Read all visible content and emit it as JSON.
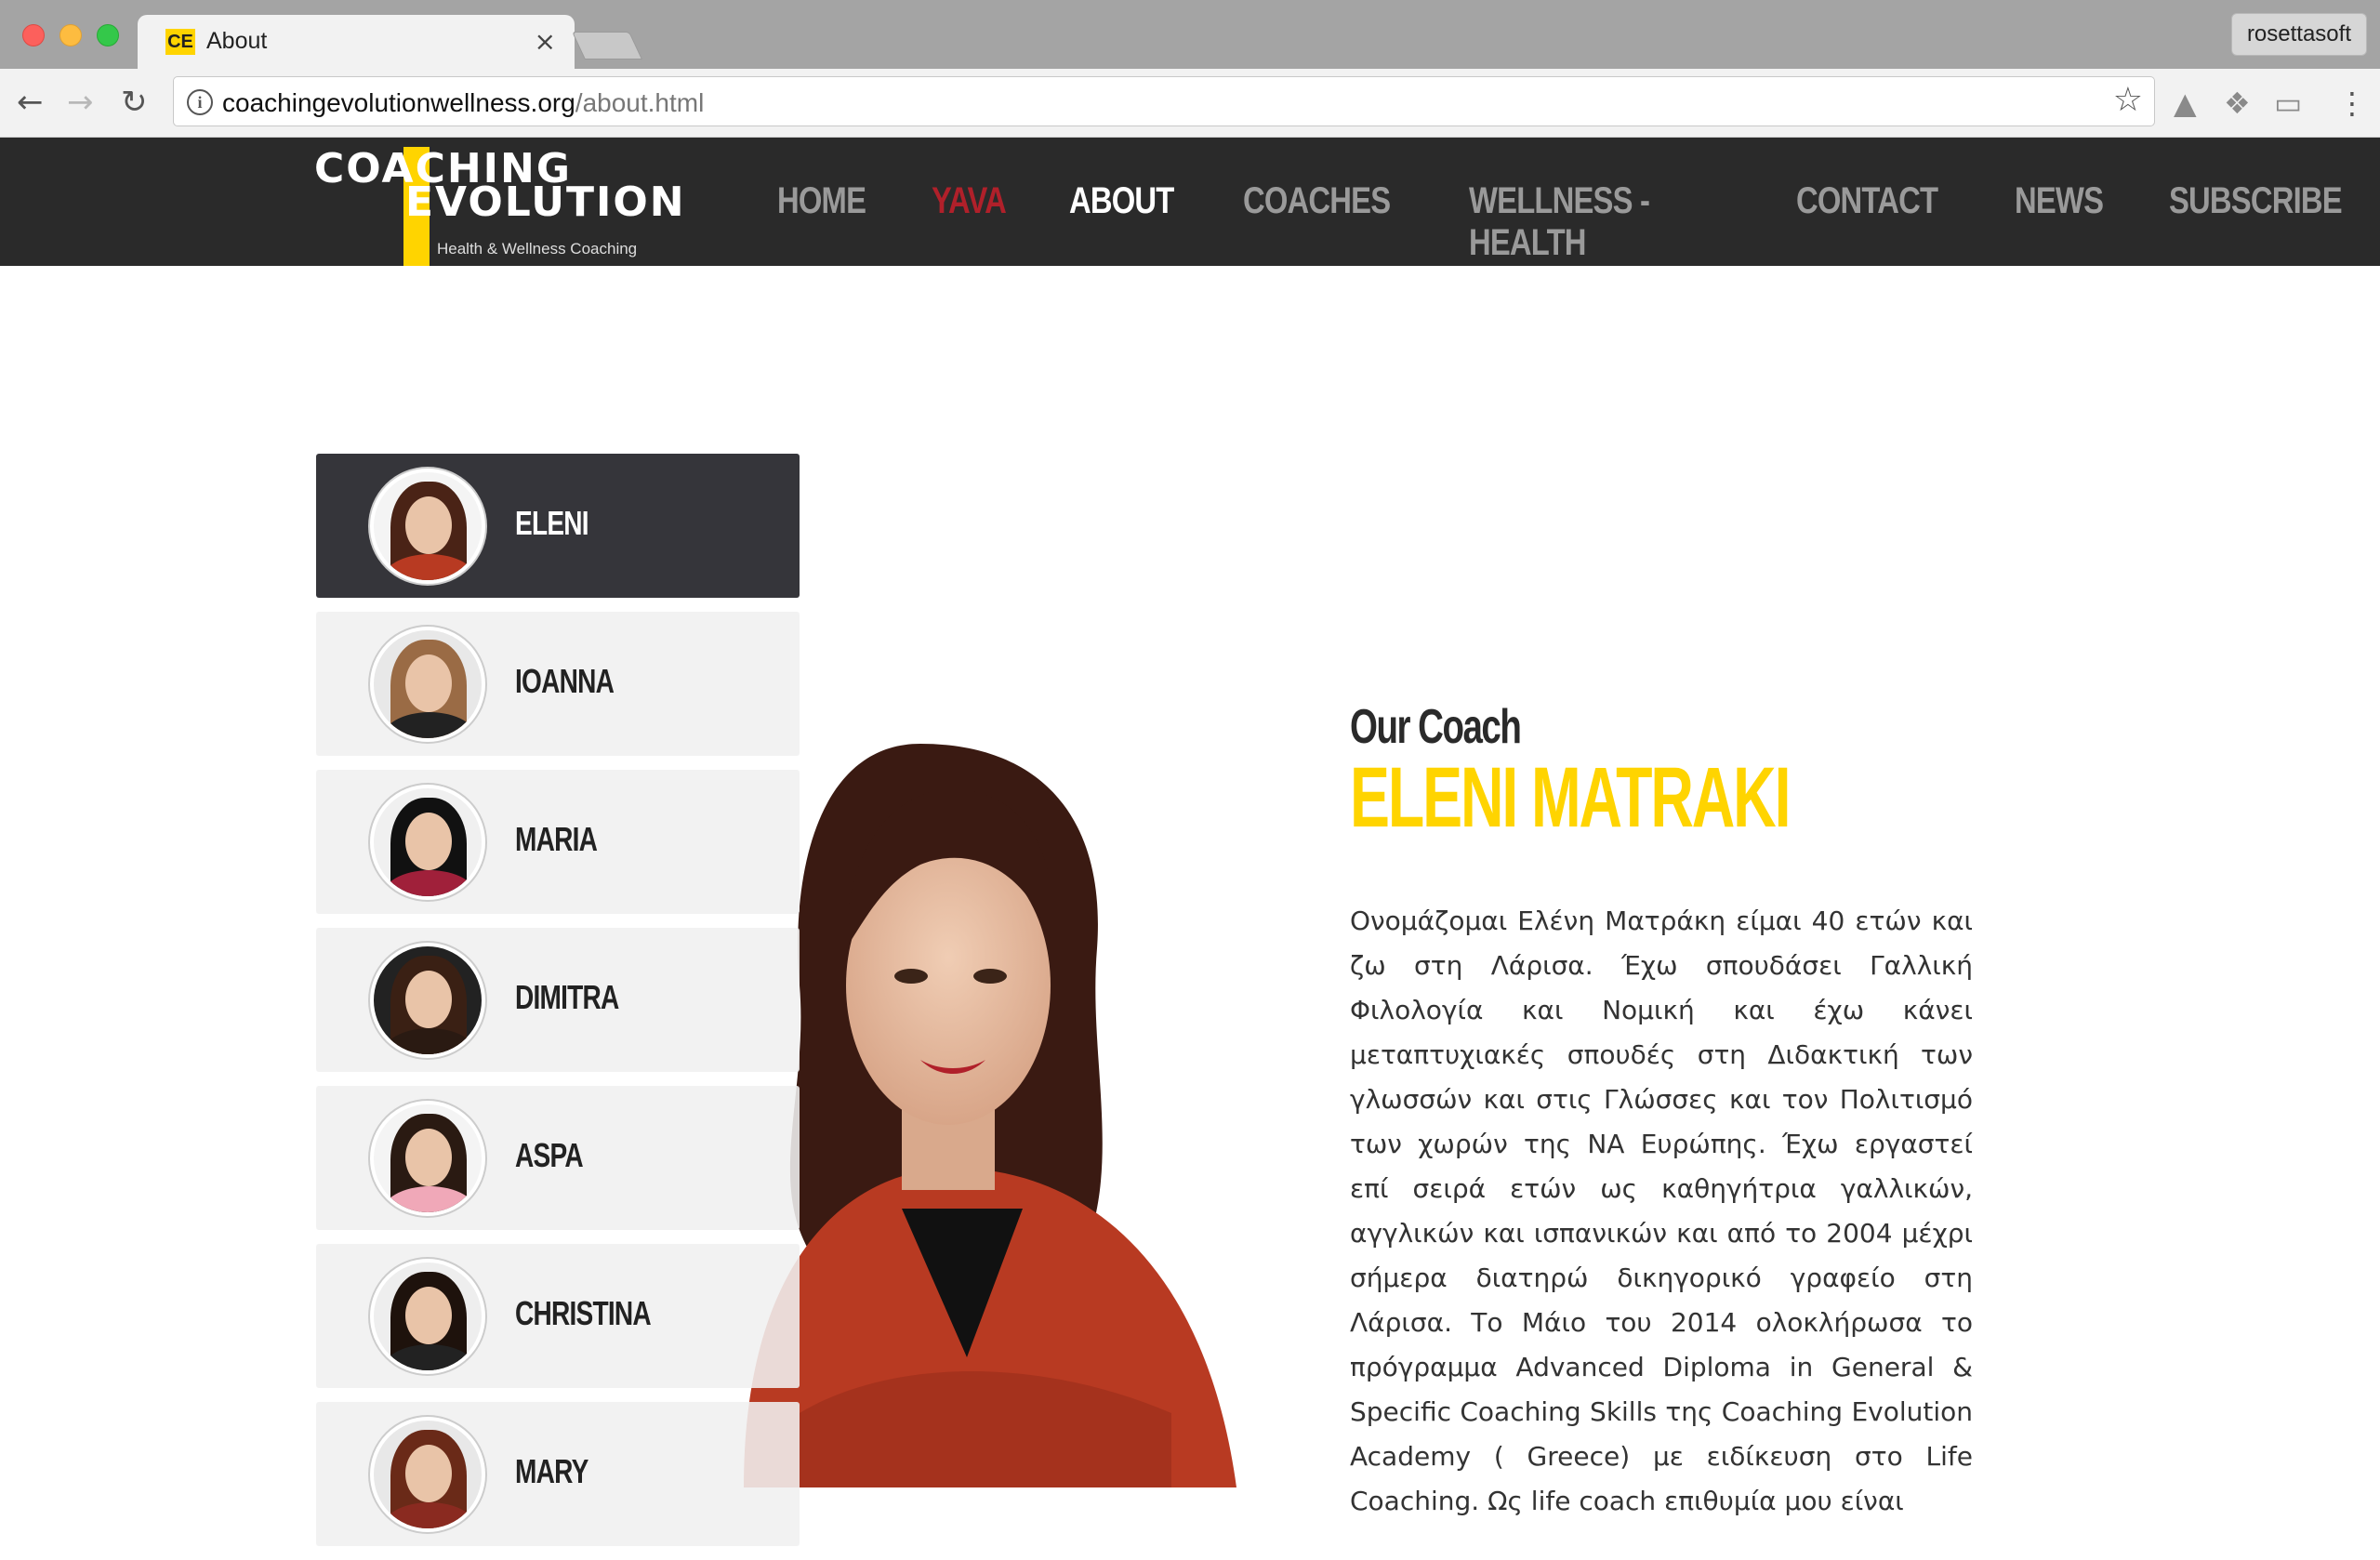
{
  "browser": {
    "tab_title": "About",
    "tab_favicon": "CE",
    "profile_name": "rosettasoft",
    "url_domain": "coachingevolutionwellness.org",
    "url_path": "/about.html"
  },
  "site": {
    "logo_line1": "COACHING",
    "logo_line2": "EVOLUTION",
    "logo_tagline": "Health & Wellness Coaching",
    "nav": [
      {
        "label": "HOME"
      },
      {
        "label": "YAVA"
      },
      {
        "label": "ABOUT"
      },
      {
        "label": "COACHES"
      },
      {
        "label": "WELLNESS - HEALTH"
      },
      {
        "label": "CONTACT"
      },
      {
        "label": "NEWS"
      },
      {
        "label": "SUBSCRIBE"
      }
    ],
    "colors": {
      "accent": "#ffd400",
      "highlight": "#b0202a",
      "header_bg": "#2a2a2a"
    }
  },
  "coaches": [
    {
      "name": "ELENI"
    },
    {
      "name": "IOANNA"
    },
    {
      "name": "MARIA"
    },
    {
      "name": "DIMITRA"
    },
    {
      "name": "ASPA"
    },
    {
      "name": "CHRISTINA"
    },
    {
      "name": "MARY"
    }
  ],
  "bio": {
    "subtitle": "Our Coach",
    "name": "ELENI MATRAKI",
    "text": "Ονομάζομαι Ελένη Ματράκη είμαι 40 ετών και ζω στη Λάρισα. Έχω σπουδάσει Γαλλική Φιλολογία και Νομική και έχω κάνει μεταπτυχιακές σπουδές στη Διδακτική των γλωσσών και στις Γλώσσες και τον Πολιτισμό των χωρών της ΝΑ Ευρώπης. Έχω εργαστεί επί σειρά ετών ως καθηγήτρια γαλλικών, αγγλικών και ισπανικών και από το 2004 μέχρι σήμερα διατηρώ δικηγορικό γραφείο στη Λάρισα. Το Μάιο του 2014 ολοκλήρωσα το πρόγραμμα Advanced Diploma in General & Specific Coaching Skills της Coaching Evolution Academy ( Greece) με ειδίκευση στο Life Coaching. Ως life coach επιθυμία μου είναι"
  }
}
